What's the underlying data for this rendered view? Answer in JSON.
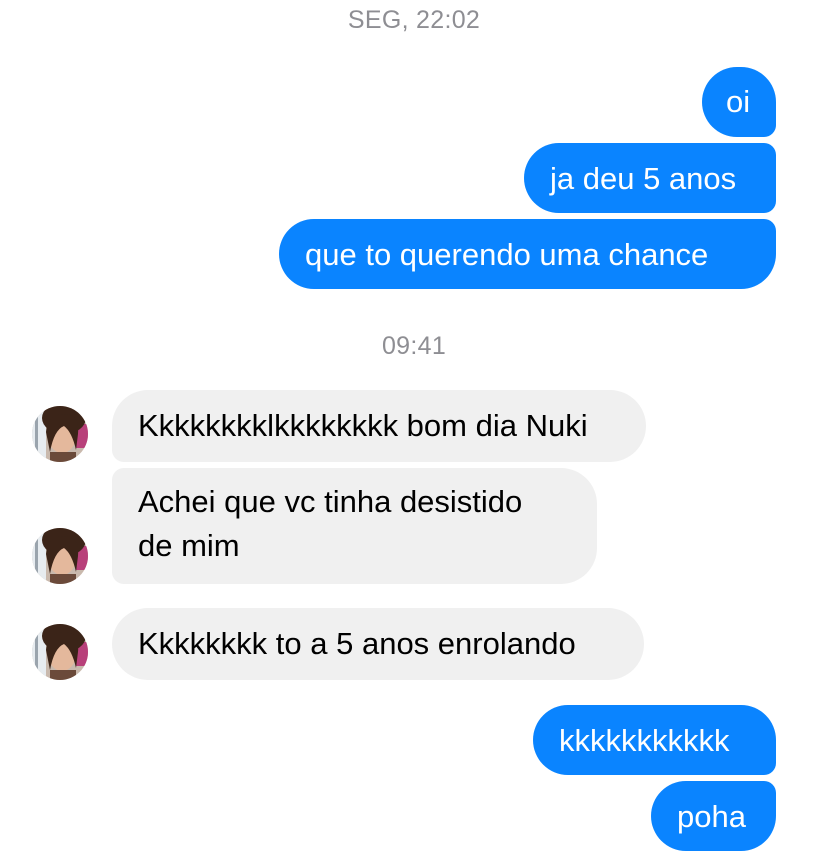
{
  "conversation": {
    "timestamps": [
      "SEG, 22:02",
      "09:41"
    ],
    "messages": [
      {
        "text": "oi"
      },
      {
        "text": "ja deu 5 anos"
      },
      {
        "text": "que to querendo uma chance"
      },
      {
        "text": "Kkkkkkkklkkkkkkkk bom dia Nuki"
      },
      {
        "text": "Achei que vc tinha desistido",
        "text2": "de mim"
      },
      {
        "text": "Kkkkkkkk to a 5 anos enrolando"
      },
      {
        "text": "kkkkkkkkkkk"
      },
      {
        "text": "poha"
      }
    ]
  },
  "colors": {
    "outgoing_bubble": "#0a84ff",
    "incoming_bubble": "#f0f0f0",
    "timestamp_text": "#8e8e93"
  },
  "icons": {
    "avatar": "contact-avatar"
  }
}
